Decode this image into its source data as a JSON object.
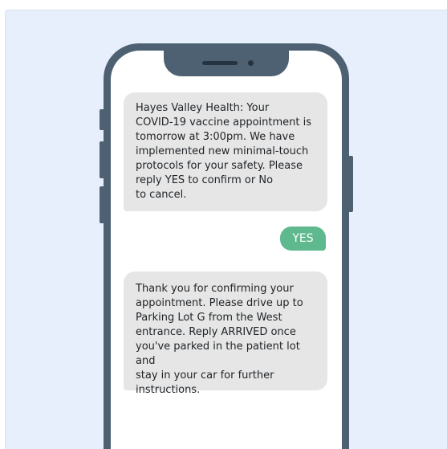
{
  "messages": [
    {
      "direction": "incoming",
      "text": "Hayes Valley Health: Your\nCOVID-19 vaccine appointment is\ntomorrow at 3:00pm. We have\nimplemented new minimal-touch\nprotocols for your safety. Please\nreply YES to confirm or No\nto cancel."
    },
    {
      "direction": "outgoing",
      "text": "YES"
    },
    {
      "direction": "incoming",
      "text": "Thank you for confirming your\nappointment. Please drive up to\nParking Lot G from the West\nentrance. Reply ARRIVED once\nyou've parked in the patient lot and\nstay in your car for further\ninstructions."
    }
  ],
  "colors": {
    "background": "#e6effb",
    "phone_frame": "#4d6173",
    "incoming_bubble": "#e6e6e6",
    "outgoing_bubble": "#5fb98e"
  }
}
